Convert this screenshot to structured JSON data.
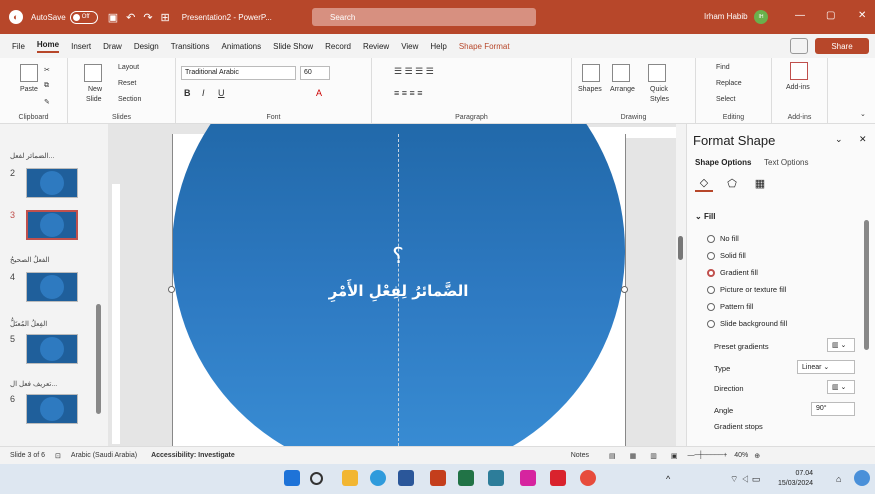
{
  "titlebar": {
    "autosave": "AutoSave",
    "toggle": "Off",
    "doc": "Presentation2 - PowerP...",
    "search": "Search",
    "user": "Irham Habib",
    "initials": "IH"
  },
  "menu": [
    "File",
    "Home",
    "Insert",
    "Draw",
    "Design",
    "Transitions",
    "Animations",
    "Slide Show",
    "Record",
    "Review",
    "View",
    "Help",
    "Shape Format"
  ],
  "share": "Share",
  "ribbon": {
    "clipboard": {
      "paste": "Paste",
      "label": "Clipboard"
    },
    "slides": {
      "new": "New",
      "slide": "Slide",
      "layout": "Layout",
      "reset": "Reset",
      "section": "Section",
      "label": "Slides"
    },
    "font": {
      "name": "Traditional Arabic",
      "size": "60",
      "label": "Font"
    },
    "paragraph": {
      "label": "Paragraph"
    },
    "drawing": {
      "shapes": "Shapes",
      "arrange": "Arrange",
      "quick": "Quick",
      "styles": "Styles",
      "label": "Drawing"
    },
    "editing": {
      "find": "Find",
      "replace": "Replace",
      "select": "Select",
      "label": "Editing"
    },
    "addins": {
      "addins": "Add-ins",
      "label": "Add-ins"
    }
  },
  "slides_pane": [
    {
      "section": "الضمائر لفعل...",
      "num": "2"
    },
    {
      "section": "",
      "num": "3",
      "selected": true
    },
    {
      "section": "الفعلُ الصحيحُ",
      "num": "4"
    },
    {
      "section": "الفِعلُ المُعتَلُّ",
      "num": "5"
    },
    {
      "section": "تعريف فعل ال...",
      "num": "6"
    }
  ],
  "slide": {
    "qmark": "؟",
    "title": "الضَّمائرُ لِفِعْلِ الأَمْرِ",
    "ruler": "16 · 14 · 12 · 10 · 8 · 6 · 4 · 2 · 0 · 2 · 4 · 6 · 8 · 10 · 12 · 14 · 16"
  },
  "format_panel": {
    "title": "Format Shape",
    "tab1": "Shape Options",
    "tab2": "Text Options",
    "section": "Fill",
    "options": [
      "No fill",
      "Solid fill",
      "Gradient fill",
      "Picture or texture fill",
      "Pattern fill",
      "Slide background fill"
    ],
    "preset": "Preset gradients",
    "type": "Type",
    "type_val": "Linear",
    "direction": "Direction",
    "angle": "Angle",
    "angle_val": "90°",
    "stops": "Gradient stops"
  },
  "status": {
    "slide": "Slide 3 of 6",
    "lang": "Arabic (Saudi Arabia)",
    "access": "Accessibility: Investigate",
    "notes": "Notes",
    "zoom": "40%"
  },
  "clock": {
    "time": "07.04",
    "date": "15/03/2024"
  }
}
